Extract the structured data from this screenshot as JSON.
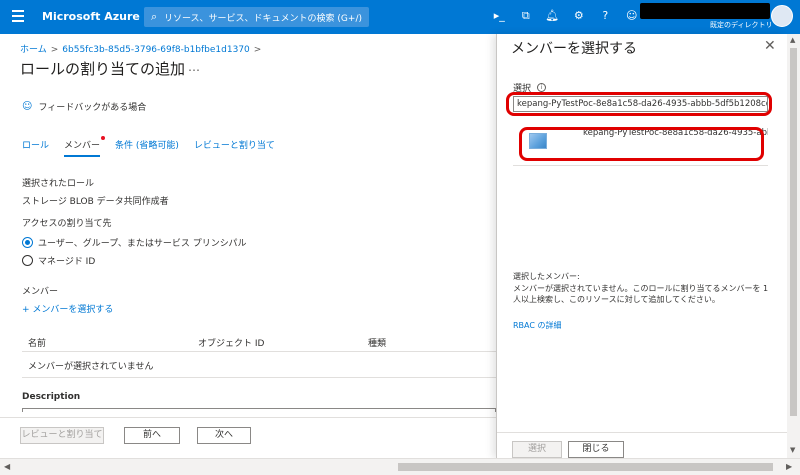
{
  "topbar": {
    "brand": "Microsoft Azure",
    "search_placeholder": "リソース、サービス、ドキュメントの検索 (G+/)",
    "directory": "既定のディレクトリ",
    "icons": [
      "cloud-shell-icon",
      "directory-filter-icon",
      "notifications-icon",
      "settings-icon",
      "help-icon",
      "feedback-icon"
    ]
  },
  "breadcrumb": {
    "home": "ホーム",
    "resource": "6b55fc3b-85d5-3796-69f8-b1bfbe1d1370"
  },
  "page": {
    "title": "ロールの割り当ての追加",
    "more": "…",
    "feedback": "フィードバックがある場合"
  },
  "tabs": [
    "ロール",
    "メンバー",
    "条件 (省略可能)",
    "レビューと割り当て"
  ],
  "members": {
    "selected_role_label": "選択されたロール",
    "selected_role_value": "ストレージ BLOB データ共同作成者",
    "access_label": "アクセスの割り当て先",
    "option_user": "ユーザー、グループ、またはサービス プリンシパル",
    "option_managed": "マネージド ID",
    "members_label": "メンバー",
    "add_members": "+ メンバーを選択する",
    "columns": [
      "名前",
      "オブジェクト ID",
      "種類"
    ],
    "empty_text": "メンバーが選択されていません",
    "description_label": "Description"
  },
  "footer_left": {
    "review": "レビューと割り当て",
    "prev": "前へ",
    "next": "次へ"
  },
  "panel": {
    "title": "メンバーを選択する",
    "select_label": "選択",
    "select_value": "kepang-PyTestPoc-8e8a1c58-da26-4935-abbb-5df5b1208cd3",
    "result_name": "kepang-PyTestPoc-8e8a1c58-da26-4935-abbb-5df5b1208cd3",
    "selected_members_label": "選択したメンバー:",
    "selected_note": "メンバーが選択されていません。このロールに割り当てるメンバーを 1 人以上検索し、このリソースに対して追加してください。",
    "rbac_link": "RBAC の詳細",
    "select_button": "選択",
    "close_button": "閉じる"
  },
  "colors": {
    "accent": "#0078d4",
    "highlight_ring": "#e00000"
  }
}
